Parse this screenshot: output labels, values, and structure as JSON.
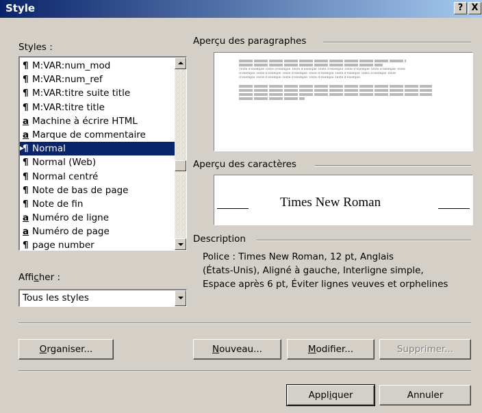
{
  "window": {
    "title": "Style",
    "help_label": "?",
    "close_label": "X"
  },
  "styles": {
    "label": "Styles :",
    "items": [
      {
        "icon": "¶",
        "label": "M:VAR:num_mod"
      },
      {
        "icon": "¶",
        "label": "M:VAR:num_ref"
      },
      {
        "icon": "¶",
        "label": "M:VAR:titre suite title"
      },
      {
        "icon": "¶",
        "label": "M:VAR:titre title"
      },
      {
        "icon": "a",
        "label": "Machine à écrire HTML"
      },
      {
        "icon": "a",
        "label": "Marque de commentaire"
      },
      {
        "icon": "¶",
        "label": "Normal"
      },
      {
        "icon": "¶",
        "label": "Normal (Web)"
      },
      {
        "icon": "¶",
        "label": "Normal centré"
      },
      {
        "icon": "¶",
        "label": "Note de bas de page"
      },
      {
        "icon": "¶",
        "label": "Note de fin"
      },
      {
        "icon": "a",
        "label": "Numéro de ligne"
      },
      {
        "icon": "a",
        "label": "Numéro de page"
      },
      {
        "icon": "¶",
        "label": "page number"
      }
    ],
    "selected": "Normal"
  },
  "afficher": {
    "label": "Afficher :",
    "value": "Tous les styles"
  },
  "preview_paragraphs": {
    "label": "Aperçu des paragraphes",
    "sample_lines": [
      "Texte d'exemple Texte d'exemple Texte d'exemple Texte d'exemple Texte d'exemple Texte d'exemple Texte",
      "d'exemple Texte d'exemple Texte d'exemple Texte d'exemple Texte d'exemple Texte d'exemple Texte",
      "d'exemple Texte d'exemple Texte d'exemple Texte d'exemple Texte d'exemple"
    ]
  },
  "preview_chars": {
    "label": "Aperçu des caractères",
    "sample": "Times New Roman"
  },
  "description": {
    "label": "Description",
    "lines": [
      "Police : Times New Roman, 12 pt, Anglais",
      "(États-Unis), Aligné à gauche, Interligne simple,",
      "Espace après 6 pt, Éviter lignes veuves et orphelines"
    ]
  },
  "buttons": {
    "organiser": "Organiser...",
    "nouveau": "Nouveau...",
    "modifier": "Modifier...",
    "supprimer": "Supprimer...",
    "appliquer": "Appliquer",
    "annuler": "Annuler"
  }
}
